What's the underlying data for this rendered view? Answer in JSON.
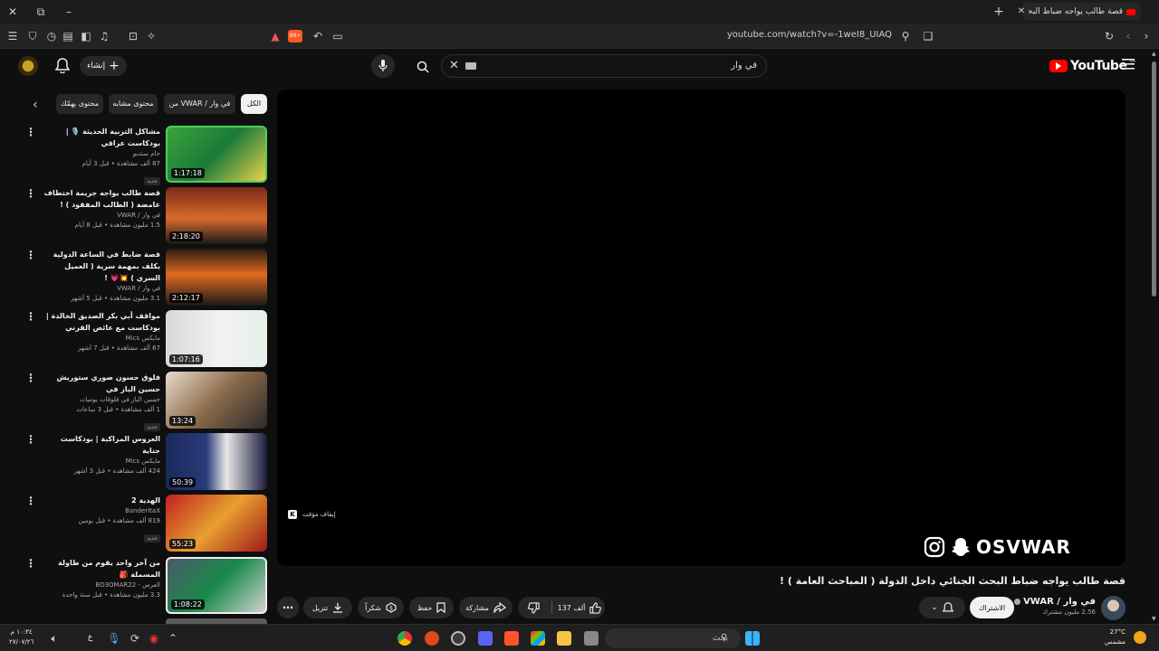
{
  "browser": {
    "tab_title": "قصة طالب يواجه ضباط البحث !",
    "url": "youtube.com/watch?v=-1weI8_UIAQ",
    "badge_count": "99+"
  },
  "header": {
    "logo_text": "YouTube",
    "logo_region": "SA",
    "search_value": "في وار",
    "create_label": "إنشاء"
  },
  "chips": [
    "الكل",
    "من VWAR / في وار",
    "محتوى مشابه",
    "محتوى يهمّك"
  ],
  "player": {
    "watermark": "OSVWAR",
    "pause_hint": "إيقاف مؤقت",
    "pause_key": "K"
  },
  "video": {
    "title": "قصة طالب يواجه ضباط البحث الجنائي داخل الدولة ( المباحث العامة ) !",
    "channel": "في وار / VWAR",
    "subscribers": "2.56 مليون مشترك",
    "subscribe_label": "الاشتراك",
    "likes": "137 ألف",
    "share_label": "مشاركة",
    "save_label": "حفظ",
    "thanks_label": "شكراً",
    "download_label": "تنزيل"
  },
  "recommendations": [
    {
      "title": "مشاكل التربية الحديثة 🎙️ | بودكاست عراقي",
      "channel": "حام ستديو",
      "meta": "87 ألف مشاهدة • قبل 3 أيام",
      "badge": "جديد",
      "duration": "1:17:18"
    },
    {
      "title": "قصة طالب يواجه جريمة اختطاف غامضة ( الطالب المفقود ) !",
      "channel": "في وار / VWAR",
      "meta": "1.5 مليون مشاهدة • قبل 8 أيام",
      "badge": "",
      "duration": "2:18:20"
    },
    {
      "title": "قصة ضابط في الساعة الدولية يكلف بمهمة سرية ( العميل السري ) 💥💗 !",
      "channel": "في وار / VWAR",
      "meta": "3.1 مليون مشاهدة • قبل 5 أشهر",
      "badge": "",
      "duration": "2:12:17"
    },
    {
      "title": "مواقف أبي بكر الصديق الخالدة | بودكاست مع عائض القرني",
      "channel": "مايكس Mics",
      "meta": "67 ألف مشاهدة • قبل 7 أشهر",
      "badge": "",
      "duration": "1:07:16"
    },
    {
      "title": "فلوق حسون صوري ستوريش حسين الباز في",
      "channel": "حسين الباز في فلوقات يوميات",
      "meta": "1 ألف مشاهدة • قبل 3 ساعات",
      "badge": "جديد",
      "duration": "13:24"
    },
    {
      "title": "العروس المراكبة | بودكاست جناية",
      "channel": "مايكس Mics",
      "meta": "424 ألف مشاهدة • قبل 3 أشهر",
      "badge": "",
      "duration": "50:39"
    },
    {
      "title": "الهدية 2",
      "channel": "BanderitaX",
      "meta": "819 ألف مشاهدة • قبل يومين",
      "badge": "جديد",
      "duration": "55:23"
    },
    {
      "title": "من آخر واحد يقوم من طاولة المسملة 🎒",
      "channel": "العرس - BO3OMAR22",
      "meta": "3.3 مليون مشاهدة • قبل سنة واحدة",
      "badge": "",
      "duration": "1:08:22"
    }
  ],
  "taskbar": {
    "search_placeholder": "بحث",
    "weather_temp": "27°C",
    "weather_text": "مشمس",
    "time": "١٠:٣٤ م",
    "date": "٢٧/٠٧/٢٦",
    "lang": "ع"
  }
}
